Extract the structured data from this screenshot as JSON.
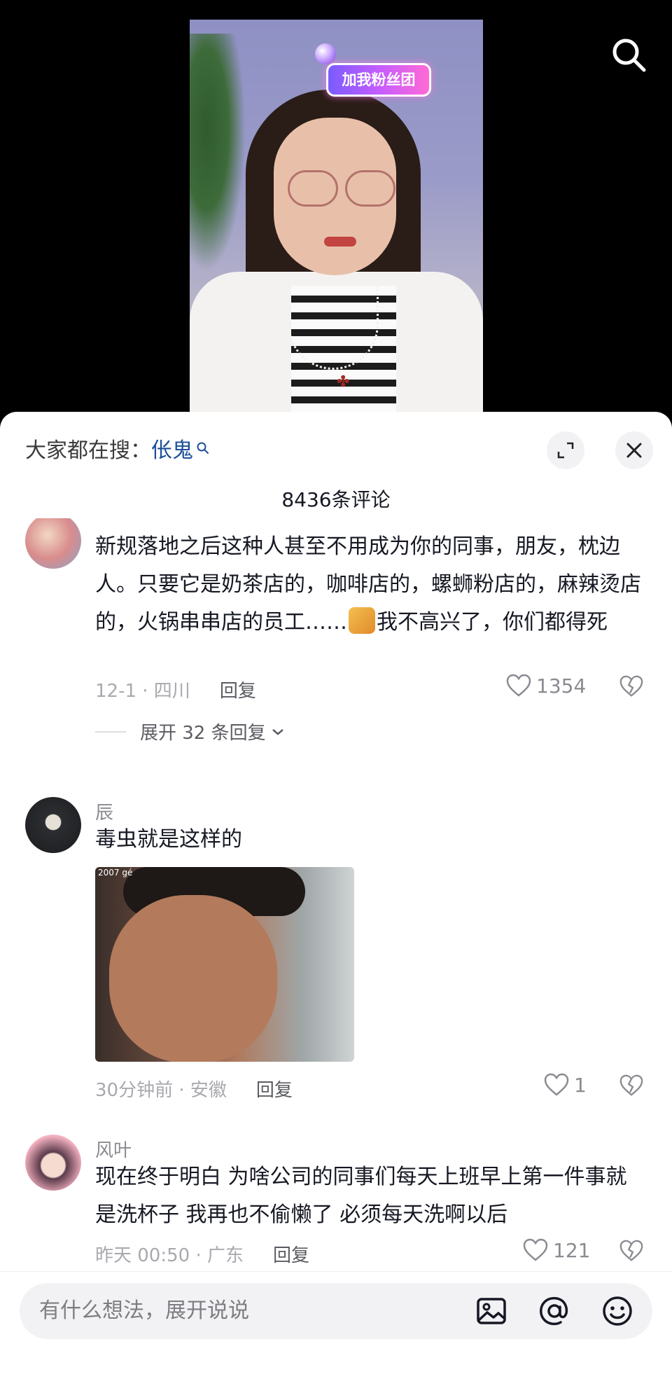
{
  "video": {
    "badge_text": "加我粉丝团"
  },
  "sheet": {
    "hot_search_label": "大家都在搜：",
    "hot_search_keyword": "伥鬼",
    "comment_count": "8436条评论"
  },
  "comments": [
    {
      "text_part1": "新规落地之后这种人甚至不用成为你的同事，朋友，枕边人。只要它是奶茶店的，咖啡店的，螺蛳粉店的，麻辣烫店的，火锅串串店的员工……",
      "text_part2": "我不高兴了，你们都得死",
      "time_location": "12-1 · 四川",
      "reply_label": "回复",
      "likes": "1354",
      "expand_replies": "展开 32 条回复"
    },
    {
      "username": "辰",
      "text": "毒虫就是这样的",
      "meme_corner": "2007 gé",
      "time_location": "30分钟前 · 安徽",
      "reply_label": "回复",
      "likes": "1"
    },
    {
      "username": "风叶",
      "text": "现在终于明白 为啥公司的同事们每天上班早上第一件事就是洗杯子   我再也不偷懒了 必须每天洗啊以后",
      "time_location": "昨天 00:50 · 广东",
      "reply_label": "回复",
      "likes": "121"
    }
  ],
  "input": {
    "placeholder": "有什么想法，展开说说"
  },
  "icons": {
    "search": "search-icon",
    "expand": "fullscreen-icon",
    "close": "close-icon",
    "like": "heart-icon",
    "dislike": "broken-heart-icon",
    "image": "image-icon",
    "mention": "at-icon",
    "emoji": "emoji-icon"
  }
}
